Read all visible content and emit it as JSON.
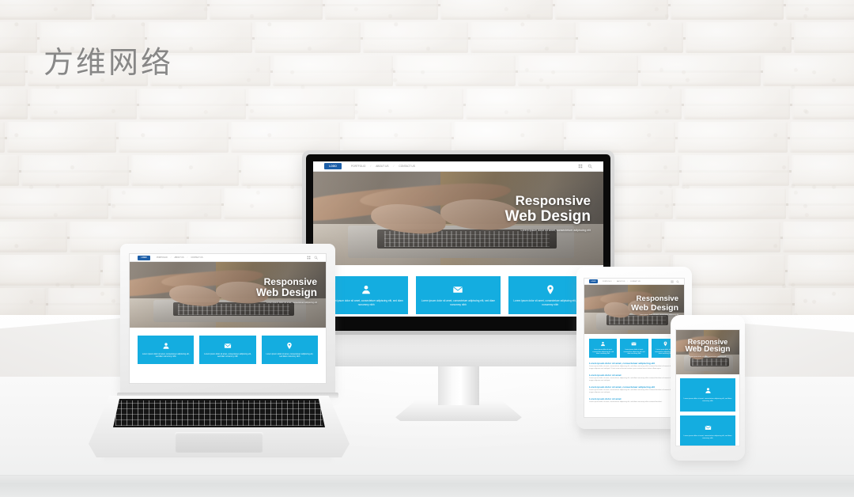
{
  "scene": {
    "watermark": "方维网络",
    "accent_blue": "#14ADE0",
    "heading_blue": "#1b9dd9",
    "logo_blue": "#1d5fa8",
    "wall": "white-painted-brick",
    "desk": "white-desk"
  },
  "site": {
    "logo_label": "LOGO",
    "nav_items": [
      {
        "label": "PORTFOLIO"
      },
      {
        "label": "ABOUT US"
      },
      {
        "label": "CONTACT US"
      }
    ],
    "nav_separator": "/",
    "nav_icons": [
      {
        "name": "grid-icon"
      },
      {
        "name": "search-icon"
      }
    ],
    "hero": {
      "title_line1": "Responsive",
      "title_line2": "Web Design",
      "subtitle": "Lorem ipsum dolor sit amet, consectetuer adipiscing elit"
    },
    "cards": [
      {
        "icon": "person-icon",
        "text": "Lorem ipsum dolor sit amet, consectetuer adipiscing elit, sed diam nonummy nibh"
      },
      {
        "icon": "envelope-icon",
        "text": "Lorem ipsum dolor sit amet, consectetuer adipiscing elit, sed diam nonummy nibh"
      },
      {
        "icon": "location-pin-icon",
        "text": "Lorem ipsum dolor sit amet, consectetuer adipiscing elit, sed diam nonummy nibh"
      }
    ],
    "articles": [
      {
        "heading": "Lorem ipsum dolor sit amet, consectetuer adipiscing elit",
        "body": "Lorem ipsum dolor sit amet, consectetuer adipiscing elit, sed diam nonummy nibh euismod tincidunt ut laoreet dolore magna aliquam erat volutpat. Ut wisi enim ad minim veniam, quis nostrud exerci tation ullamcorper."
      },
      {
        "heading": "Lorem ipsum dolor sit amet",
        "body": "Lorem ipsum dolor sit amet, consectetuer adipiscing elit, sed diam nonummy nibh euismod tincidunt ut laoreet dolore magna aliquam erat volutpat."
      },
      {
        "heading": "Lorem ipsum dolor sit amet, consectetuer adipiscing elit",
        "body": "Lorem ipsum dolor sit amet, consectetuer adipiscing elit, sed diam nonummy nibh euismod tincidunt ut laoreet dolore magna aliquam erat volutpat."
      },
      {
        "heading": "Lorem ipsum dolor sit amet",
        "body": "Lorem ipsum dolor sit amet, consectetuer adipiscing elit, sed diam nonummy nibh euismod tincidunt."
      }
    ]
  },
  "devices": [
    {
      "name": "desktop-monitor"
    },
    {
      "name": "laptop"
    },
    {
      "name": "tablet"
    },
    {
      "name": "smartphone"
    }
  ]
}
